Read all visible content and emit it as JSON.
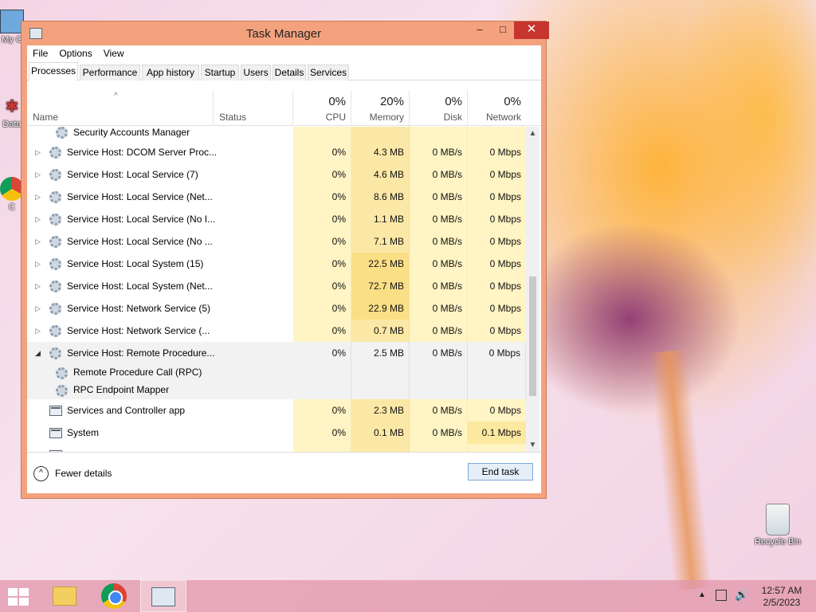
{
  "desktop": {
    "icons_left": [
      {
        "label": "My C",
        "icon": "computer-icon"
      },
      {
        "label": "Data",
        "icon": "data-icon"
      },
      {
        "label": "C",
        "icon": "chrome-icon"
      }
    ],
    "recycle_bin": {
      "label": "Recycle Bin",
      "icon": "recycle-bin-icon"
    }
  },
  "window": {
    "title": "Task Manager",
    "controls": {
      "minimize": "–",
      "maximize": "□",
      "close": "✕"
    },
    "menu": [
      "File",
      "Options",
      "View"
    ],
    "tabs": [
      {
        "label": "Processes",
        "active": true
      },
      {
        "label": "Performance"
      },
      {
        "label": "App history"
      },
      {
        "label": "Startup"
      },
      {
        "label": "Users"
      },
      {
        "label": "Details"
      },
      {
        "label": "Services"
      }
    ],
    "columns": {
      "name": "Name",
      "status": "Status",
      "cpu": {
        "pct": "0%",
        "label": "CPU"
      },
      "memory": {
        "pct": "20%",
        "label": "Memory"
      },
      "disk": {
        "pct": "0%",
        "label": "Disk"
      },
      "network": {
        "pct": "0%",
        "label": "Network"
      }
    },
    "rows": [
      {
        "name": "Security Accounts Manager",
        "kind": "sub-partial"
      },
      {
        "name": "Service Host: DCOM Server Proc...",
        "cpu": "0%",
        "memory": "4.3 MB",
        "disk": "0 MB/s",
        "network": "0 Mbps"
      },
      {
        "name": "Service Host: Local Service (7)",
        "cpu": "0%",
        "memory": "4.6 MB",
        "disk": "0 MB/s",
        "network": "0 Mbps"
      },
      {
        "name": "Service Host: Local Service (Net...",
        "cpu": "0%",
        "memory": "8.6 MB",
        "disk": "0 MB/s",
        "network": "0 Mbps"
      },
      {
        "name": "Service Host: Local Service (No I...",
        "cpu": "0%",
        "memory": "1.1 MB",
        "disk": "0 MB/s",
        "network": "0 Mbps"
      },
      {
        "name": "Service Host: Local Service (No ...",
        "cpu": "0%",
        "memory": "7.1 MB",
        "disk": "0 MB/s",
        "network": "0 Mbps"
      },
      {
        "name": "Service Host: Local System (15)",
        "cpu": "0%",
        "memory": "22.5 MB",
        "disk": "0 MB/s",
        "network": "0 Mbps"
      },
      {
        "name": "Service Host: Local System (Net...",
        "cpu": "0%",
        "memory": "72.7 MB",
        "disk": "0 MB/s",
        "network": "0 Mbps"
      },
      {
        "name": "Service Host: Network Service (5)",
        "cpu": "0%",
        "memory": "22.9 MB",
        "disk": "0 MB/s",
        "network": "0 Mbps"
      },
      {
        "name": "Service Host: Network Service (...",
        "cpu": "0%",
        "memory": "0.7 MB",
        "disk": "0 MB/s",
        "network": "0 Mbps"
      },
      {
        "name": "Service Host: Remote Procedure...",
        "cpu": "0%",
        "memory": "2.5 MB",
        "disk": "0 MB/s",
        "network": "0 Mbps",
        "expanded": true,
        "children": [
          "Remote Procedure Call (RPC)",
          "RPC Endpoint Mapper"
        ]
      },
      {
        "name": "Services and Controller app",
        "cpu": "0%",
        "memory": "2.3 MB",
        "disk": "0 MB/s",
        "network": "0 Mbps"
      },
      {
        "name": "System",
        "cpu": "0%",
        "memory": "0.1 MB",
        "disk": "0 MB/s",
        "network": "0.1 Mbps"
      }
    ],
    "footer": {
      "fewer_details": "Fewer details",
      "end_task": "End task"
    }
  },
  "taskbar": {
    "clock_time": "12:57 AM",
    "clock_date": "2/5/2023",
    "tray_icons": [
      "chevron-up-icon",
      "network-icon",
      "volume-icon"
    ]
  }
}
